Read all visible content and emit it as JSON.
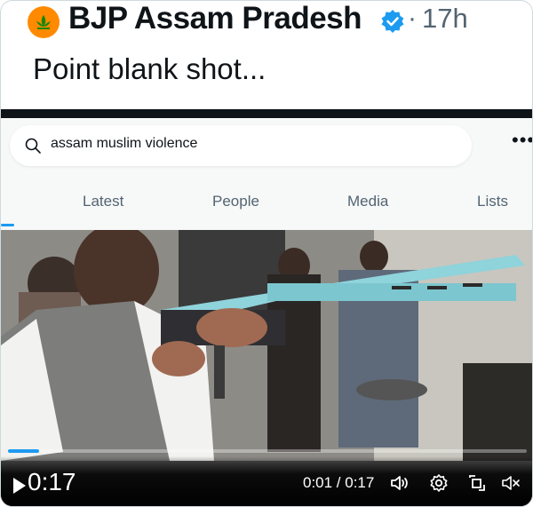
{
  "account": {
    "name": "BJP Assam Pradesh",
    "separator": "·",
    "time": "17h"
  },
  "tweet": {
    "text": "Point blank shot..."
  },
  "search": {
    "query": "assam muslim violence"
  },
  "tabs": [
    {
      "label": "Latest"
    },
    {
      "label": "People"
    },
    {
      "label": "Media"
    },
    {
      "label": "Lists"
    }
  ],
  "video": {
    "duration_big": "0:17",
    "timecode": "0:01 / 0:17",
    "progress": 0.06
  },
  "colors": {
    "accent": "#1d9bf0",
    "saffron": "#ff8a00",
    "text": "#0f1419",
    "muted": "#536471"
  },
  "icons": [
    "bjp-lotus-icon",
    "verified-badge-icon",
    "search-icon",
    "more-icon",
    "play-icon",
    "volume-icon",
    "settings-icon",
    "fullscreen-icon",
    "mute-icon"
  ]
}
